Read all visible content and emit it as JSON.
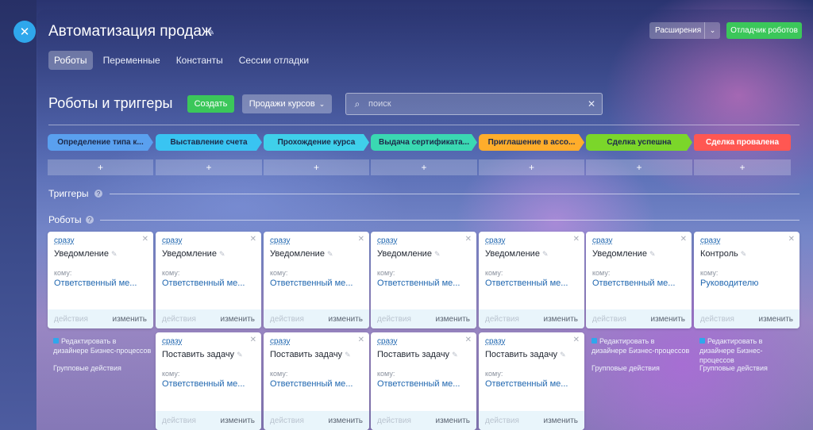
{
  "window": {
    "title": "Автоматизация продаж",
    "close_icon": "close-icon",
    "pin_icon": "pin-icon"
  },
  "header": {
    "extensions_label": "Расширения",
    "debugger_label": "Отладчик роботов"
  },
  "tabs": [
    {
      "label": "Роботы",
      "active": true
    },
    {
      "label": "Переменные",
      "active": false
    },
    {
      "label": "Константы",
      "active": false
    },
    {
      "label": "Сессии отладки",
      "active": false
    }
  ],
  "toolbar": {
    "section_title": "Роботы и триггеры",
    "create_label": "Создать",
    "funnel_label": "Продажи курсов",
    "search_placeholder": "поиск"
  },
  "stages": [
    {
      "label": "Определение типа к...",
      "color": "#5aa0ef"
    },
    {
      "label": "Выставление счета",
      "color": "#39c4f2"
    },
    {
      "label": "Прохождение курса",
      "color": "#3fd0ea"
    },
    {
      "label": "Выдача сертификата...",
      "color": "#3ad8b2"
    },
    {
      "label": "Приглашение в ассо...",
      "color": "#ffad2b"
    },
    {
      "label": "Сделка успешна",
      "color": "#7bd62a"
    },
    {
      "label": "Сделка провалена",
      "color": "#ff5752"
    }
  ],
  "add_symbol": "+",
  "rows": {
    "triggers_label": "Триггеры",
    "robots_label": "Роботы",
    "help_symbol": "?"
  },
  "robots_row1": [
    {
      "when": "сразу",
      "title": "Уведомление",
      "to_label": "кому:",
      "to": "Ответственный ме...",
      "actions": "действия",
      "edit": "изменить"
    },
    {
      "when": "сразу",
      "title": "Уведомление",
      "to_label": "кому:",
      "to": "Ответственный ме...",
      "actions": "действия",
      "edit": "изменить"
    },
    {
      "when": "сразу",
      "title": "Уведомление",
      "to_label": "кому:",
      "to": "Ответственный ме...",
      "actions": "действия",
      "edit": "изменить"
    },
    {
      "when": "сразу",
      "title": "Уведомление",
      "to_label": "кому:",
      "to": "Ответственный ме...",
      "actions": "действия",
      "edit": "изменить"
    },
    {
      "when": "сразу",
      "title": "Уведомление",
      "to_label": "кому:",
      "to": "Ответственный ме...",
      "actions": "действия",
      "edit": "изменить"
    },
    {
      "when": "сразу",
      "title": "Уведомление",
      "to_label": "кому:",
      "to": "Ответственный ме...",
      "actions": "действия",
      "edit": "изменить"
    },
    {
      "when": "сразу",
      "title": "Контроль",
      "to_label": "кому:",
      "to": "Руководителю",
      "actions": "действия",
      "edit": "изменить"
    }
  ],
  "robots_row2": [
    {
      "when": "сразу",
      "title": "Поставить задачу",
      "to_label": "кому:",
      "to": "Ответственный ме...",
      "actions": "действия",
      "edit": "изменить"
    },
    {
      "when": "сразу",
      "title": "Поставить задачу",
      "to_label": "кому:",
      "to": "Ответственный ме...",
      "actions": "действия",
      "edit": "изменить"
    },
    {
      "when": "сразу",
      "title": "Поставить задачу",
      "to_label": "кому:",
      "to": "Ответственный ме...",
      "actions": "действия",
      "edit": "изменить"
    },
    {
      "when": "сразу",
      "title": "Поставить задачу",
      "to_label": "кому:",
      "to": "Ответственный ме...",
      "actions": "действия",
      "edit": "изменить"
    }
  ],
  "side_links": {
    "edit_designer": "Редактировать в дизайнере Бизнес-процессов",
    "group_actions": "Групповые действия"
  }
}
